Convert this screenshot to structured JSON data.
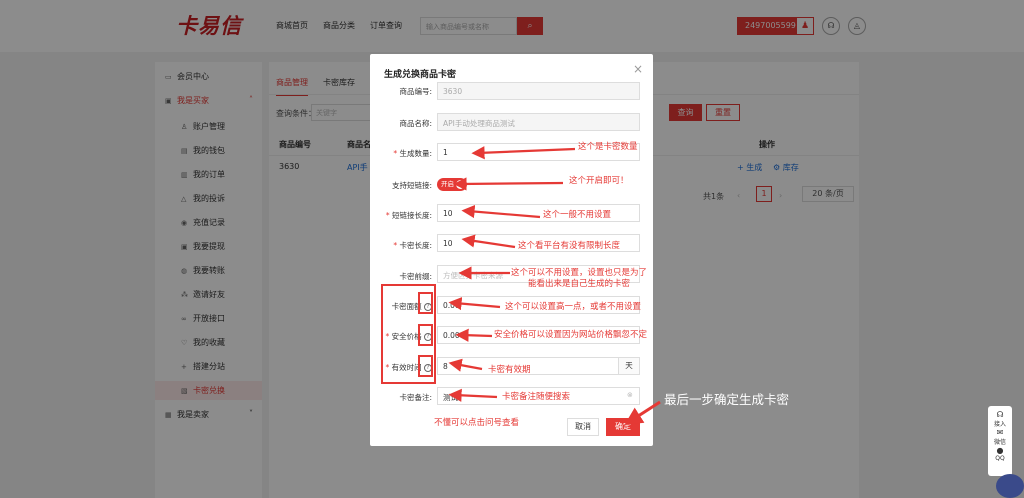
{
  "header": {
    "logo_text": "卡易信",
    "nav": [
      "商城首页",
      "商品分类",
      "订单查询"
    ],
    "search_placeholder": "输入商品编号或名称",
    "search_icon": "search-icon",
    "account_id": "2497005599",
    "account_icon": "user-icon",
    "headset_icon": "headset-icon",
    "bell_icon": "bell-icon"
  },
  "sidebar": {
    "items": [
      {
        "label": "会员中心",
        "icon": "monitor-icon"
      },
      {
        "label": "我是买家",
        "icon": "user-icon"
      },
      {
        "label": "账户管理",
        "icon": "user-icon"
      },
      {
        "label": "我的钱包",
        "icon": "wallet-icon"
      },
      {
        "label": "我的订单",
        "icon": "order-icon"
      },
      {
        "label": "我的投诉",
        "icon": "warning-icon"
      },
      {
        "label": "充值记录",
        "icon": "recharge-icon"
      },
      {
        "label": "我要提现",
        "icon": "withdraw-icon"
      },
      {
        "label": "我要转账",
        "icon": "transfer-icon"
      },
      {
        "label": "邀请好友",
        "icon": "invite-icon"
      },
      {
        "label": "开放接口",
        "icon": "link-icon"
      },
      {
        "label": "我的收藏",
        "icon": "heart-icon"
      },
      {
        "label": "搭建分站",
        "icon": "plus-icon"
      },
      {
        "label": "卡密兑换",
        "icon": "exchange-icon"
      },
      {
        "label": "我是卖家",
        "icon": "store-icon"
      }
    ]
  },
  "main": {
    "tabs": [
      "商品管理",
      "卡密库存"
    ],
    "filter_label": "查询条件：",
    "filter_placeholder": "关键字",
    "query_button": "查询",
    "reset_button": "重置",
    "columns": [
      "商品编号",
      "商品名",
      "操作"
    ],
    "rows": [
      {
        "id": "3630",
        "name": "API手",
        "gen_action": "+ 生成",
        "stock_action": "⚙ 库存"
      }
    ],
    "pagination": {
      "total": "共1条",
      "prev": "‹",
      "page": "1",
      "next": "›",
      "page_size": "20 条/页"
    }
  },
  "dialog": {
    "title": "生成兑换商品卡密",
    "close": "×",
    "fields": {
      "product_id_label": "商品编号:",
      "product_id_value": "3630",
      "product_name_label": "商品名称:",
      "product_name_value": "API手动处理商品测试",
      "quantity_label": "生成数量:",
      "quantity_value": "1",
      "shortlink_label": "支持短链接:",
      "shortlink_toggle": "开启",
      "shortlink_len_label": "短链接长度:",
      "shortlink_len_value": "10",
      "card_len_label": "卡密长度:",
      "card_len_value": "10",
      "prefix_label": "卡密前缀:",
      "prefix_placeholder": "方便区分卡密来源",
      "face_value_label": "卡密面额",
      "face_value_value": "0.00",
      "safe_price_label": "安全价格",
      "safe_price_value": "0.00",
      "validity_label": "有效时间",
      "validity_value": "8",
      "validity_unit": "天",
      "remark_label": "卡密备注:",
      "remark_value": "测试"
    },
    "cancel_button": "取消",
    "confirm_button": "确定"
  },
  "annotations": {
    "quantity": "这个是卡密数量",
    "toggle": "这个开启即可！",
    "shortlink": "这个一般不用设置",
    "cardlen": "这个看平台有没有限制长度",
    "prefix": "这个可以不用设置，设置也只是为了\n能看出来是自己生成的卡密",
    "face": "这个可以设置高一点，或者不用设置",
    "safe": "安全价格可以设置因为网站价格飘忽不定",
    "validity": "卡密有效期",
    "remark": "卡密备注随便搜索",
    "help": "不懂可以点击问号查看",
    "final": "最后一步确定生成卡密"
  },
  "float_widget": {
    "items": [
      "接入",
      "微信",
      "QQ"
    ]
  },
  "colors": {
    "accent": "#e53935",
    "mask": "rgba(0,0,0,0.45)"
  }
}
